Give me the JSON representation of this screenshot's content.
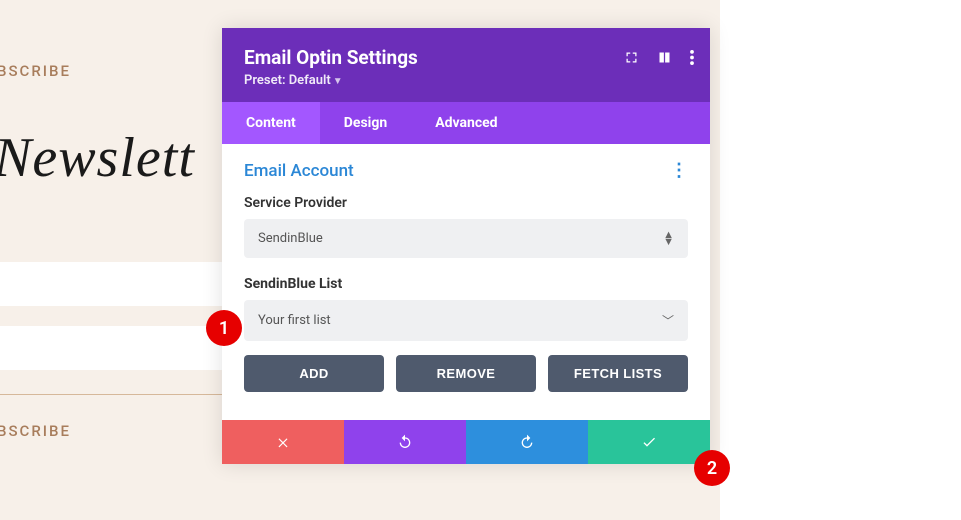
{
  "background": {
    "subscribe_top": "BSCRIBE",
    "subscribe_bottom": "BSCRIBE",
    "newsletter": "Newslett"
  },
  "modal": {
    "title": "Email Optin Settings",
    "preset_prefix": "Preset: ",
    "preset_value": "Default",
    "tabs": {
      "content": "Content",
      "design": "Design",
      "advanced": "Advanced"
    },
    "section_title": "Email Account",
    "service_provider_label": "Service Provider",
    "service_provider_value": "SendinBlue",
    "list_label": "SendinBlue List",
    "list_value": "Your first list",
    "buttons": {
      "add": "ADD",
      "remove": "REMOVE",
      "fetch": "FETCH LISTS"
    }
  },
  "badges": {
    "one": "1",
    "two": "2"
  }
}
